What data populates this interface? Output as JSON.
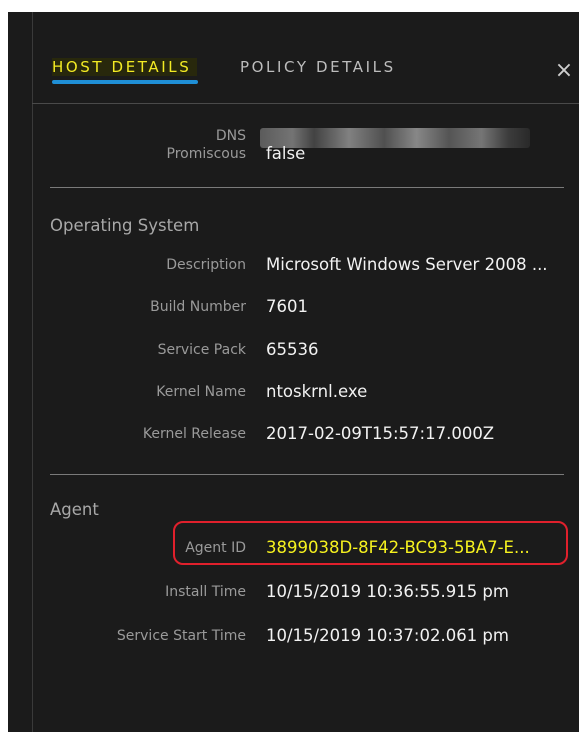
{
  "tabs": {
    "host_details": "HOST DETAILS",
    "policy_details": "POLICY DETAILS"
  },
  "close_glyph": "×",
  "network": {
    "dns_label": "DNS",
    "promiscuous_label": "Promiscous",
    "promiscuous_value": "false"
  },
  "operating_system": {
    "title": "Operating System",
    "rows": [
      {
        "label": "Description",
        "value": "Microsoft Windows Server 2008 ..."
      },
      {
        "label": "Build Number",
        "value": "7601"
      },
      {
        "label": "Service Pack",
        "value": "65536"
      },
      {
        "label": "Kernel Name",
        "value": "ntoskrnl.exe"
      },
      {
        "label": "Kernel Release",
        "value": "2017-02-09T15:57:17.000Z"
      }
    ]
  },
  "agent": {
    "title": "Agent",
    "rows": [
      {
        "label": "Agent ID",
        "value": "3899038D-8F42-BC93-5BA7-E..."
      },
      {
        "label": "Install Time",
        "value": "10/15/2019 10:36:55.915 pm"
      },
      {
        "label": "Service Start Time",
        "value": "10/15/2019 10:37:02.061 pm"
      }
    ]
  },
  "colors": {
    "panel_bg": "#1b1b1b",
    "active_tab": "#f3eb24",
    "tab_underline": "#1f8fd6",
    "agent_id_value": "#f6f21f",
    "highlight_border": "#e0202c"
  }
}
